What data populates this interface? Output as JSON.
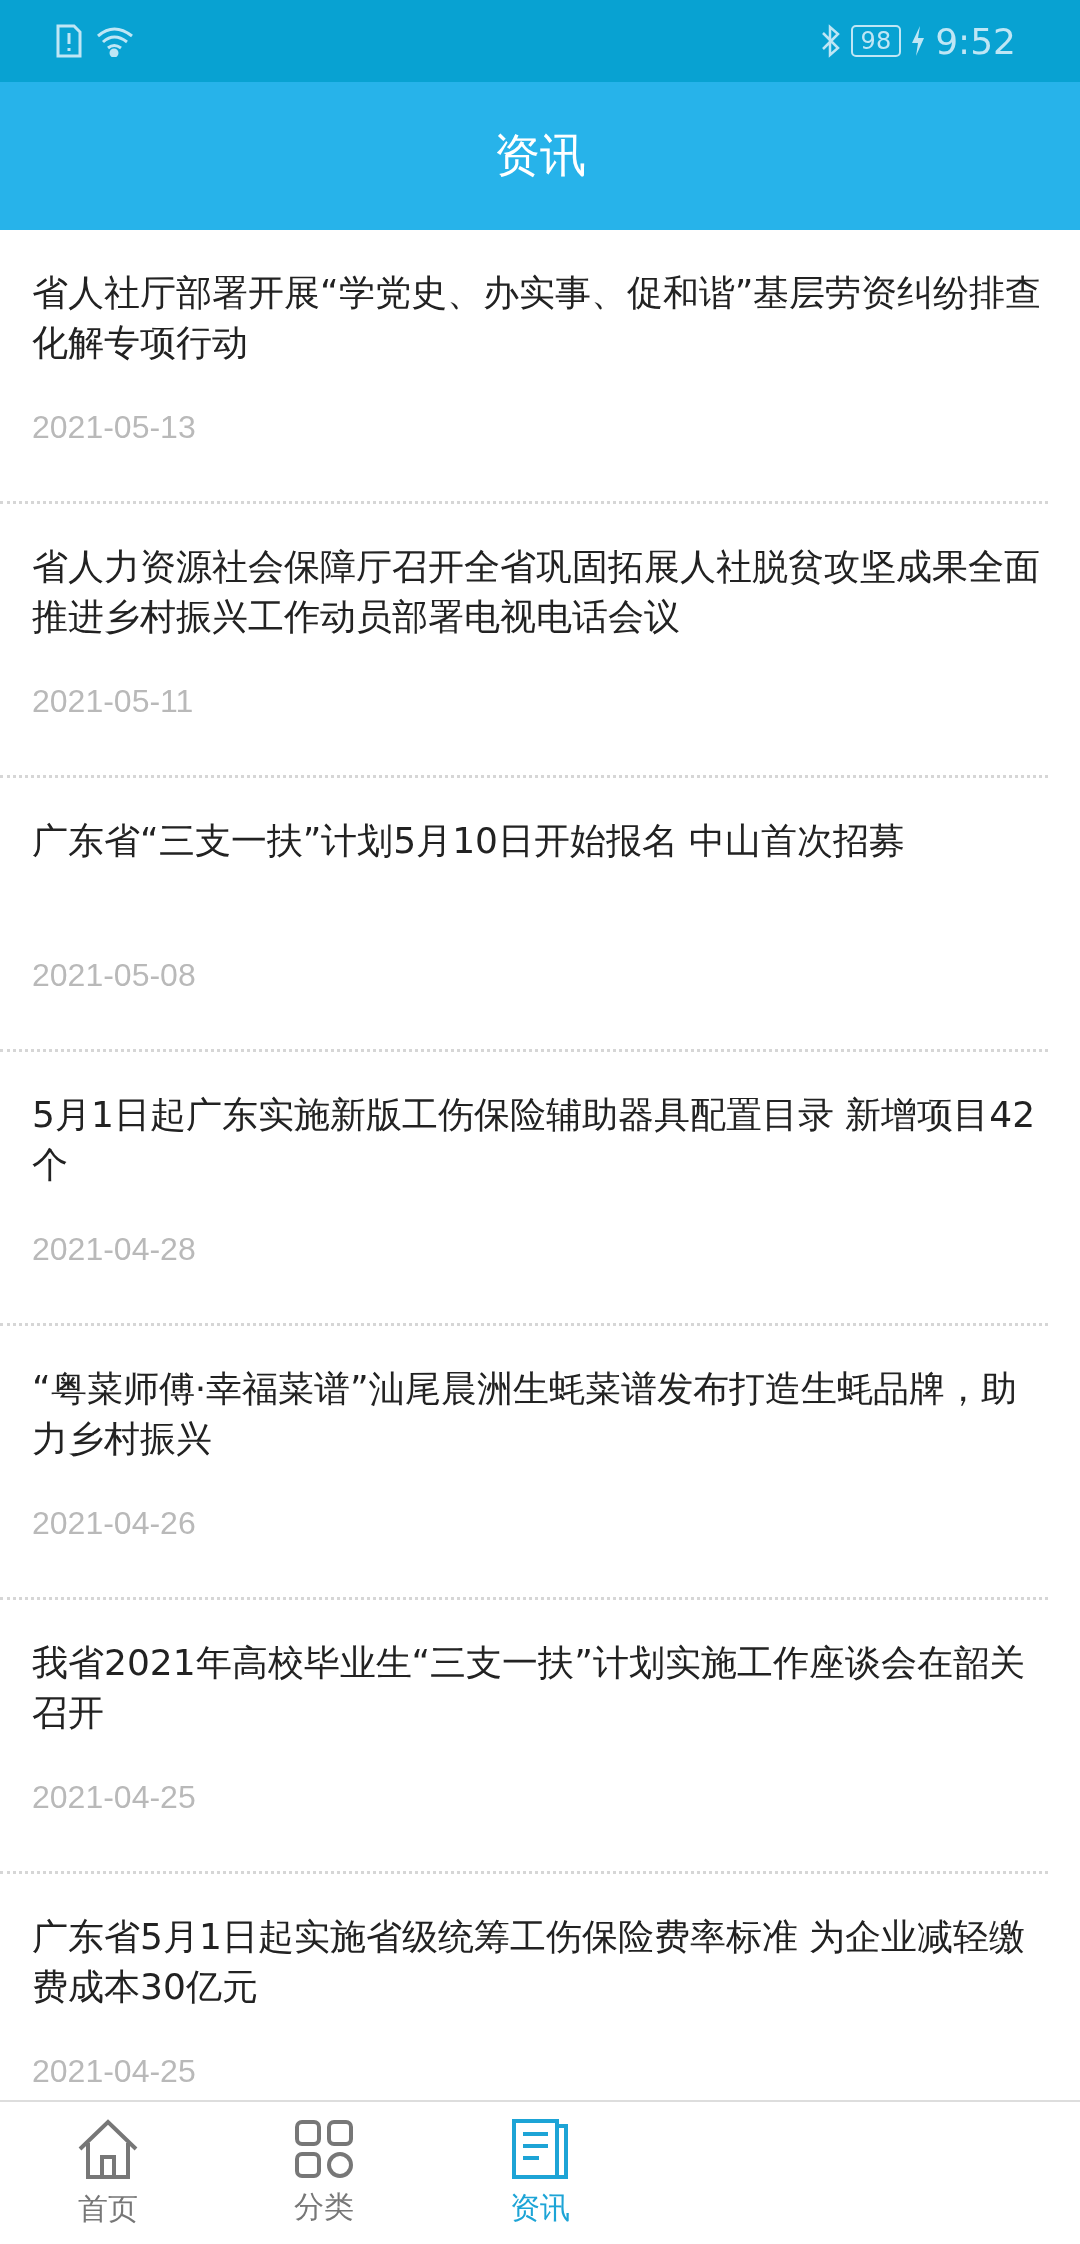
{
  "status_bar": {
    "battery": "98",
    "time": "9:52"
  },
  "header": {
    "title": "资讯"
  },
  "news": [
    {
      "title": "省人社厅部署开展“学党史、办实事、促和谐”基层劳资纠纷排查化解专项行动",
      "date": "2021-05-13"
    },
    {
      "title": "省人力资源社会保障厅召开全省巩固拓展人社脱贫攻坚成果全面推进乡村振兴工作动员部署电视电话会议",
      "date": "2021-05-11"
    },
    {
      "title": "广东省“三支一扶”计划5月10日开始报名  中山首次招募",
      "date": "2021-05-08"
    },
    {
      "title": "5月1日起广东实施新版工伤保险辅助器具配置目录 新增项目42个",
      "date": "2021-04-28"
    },
    {
      "title": "“粤菜师傅·幸福菜谱”汕尾晨洲生蚝菜谱发布打造生蚝品牌，助力乡村振兴",
      "date": "2021-04-26"
    },
    {
      "title": "我省2021年高校毕业生“三支一扶”计划实施工作座谈会在韶关召开",
      "date": "2021-04-25"
    },
    {
      "title": "广东省5月1日起实施省级统筹工伤保险费率标准 为企业减轻缴费成本30亿元",
      "date": "2021-04-25"
    }
  ],
  "tabs": [
    {
      "label": "首页",
      "kind": "home",
      "selected": false
    },
    {
      "label": "分类",
      "kind": "grid",
      "selected": false
    },
    {
      "label": "资讯",
      "kind": "news",
      "selected": true
    }
  ]
}
